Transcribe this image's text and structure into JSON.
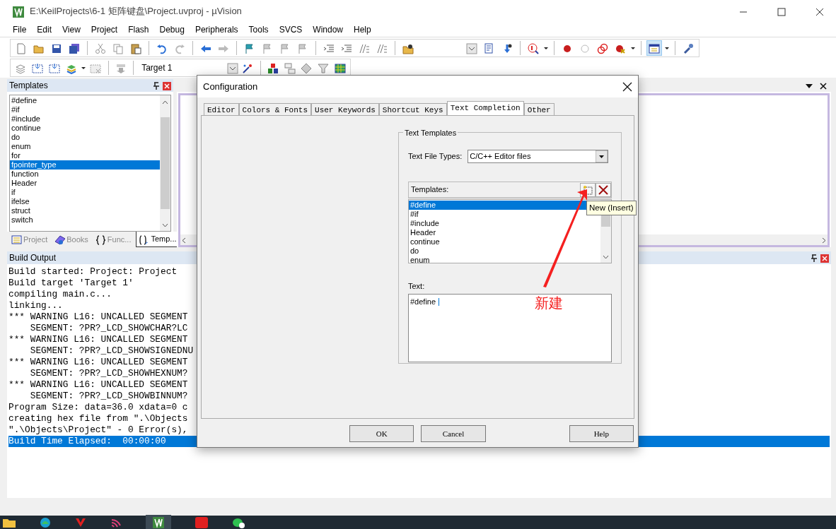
{
  "window": {
    "title": "E:\\KeilProjects\\6-1 矩阵键盘\\Project.uvproj - µVision"
  },
  "menu": [
    "File",
    "Edit",
    "View",
    "Project",
    "Flash",
    "Debug",
    "Peripherals",
    "Tools",
    "SVCS",
    "Window",
    "Help"
  ],
  "toolbar": {
    "target": "Target 1"
  },
  "templates_panel": {
    "title": "Templates",
    "items": [
      {
        "label": "#define",
        "selected": false
      },
      {
        "label": "#if",
        "selected": false
      },
      {
        "label": "#include",
        "selected": false
      },
      {
        "label": "continue",
        "selected": false
      },
      {
        "label": "do",
        "selected": false
      },
      {
        "label": "enum",
        "selected": false
      },
      {
        "label": "for",
        "selected": false
      },
      {
        "label": "fpointer_type",
        "selected": true
      },
      {
        "label": "function",
        "selected": false
      },
      {
        "label": "Header",
        "selected": false
      },
      {
        "label": "if",
        "selected": false
      },
      {
        "label": "ifelse",
        "selected": false
      },
      {
        "label": "struct",
        "selected": false
      },
      {
        "label": "switch",
        "selected": false
      }
    ],
    "tabs": [
      {
        "label": "Project",
        "kind": "project",
        "selected": false
      },
      {
        "label": "Books",
        "kind": "books",
        "selected": false
      },
      {
        "label": "Func...",
        "kind": "functions",
        "selected": false
      },
      {
        "label": "Temp...",
        "kind": "templates",
        "selected": true
      }
    ]
  },
  "build_output": {
    "title": "Build Output",
    "lines": [
      {
        "text": "Build started: Project: Project",
        "selected": false
      },
      {
        "text": "Build target 'Target 1'",
        "selected": false
      },
      {
        "text": "compiling main.c...",
        "selected": false
      },
      {
        "text": "linking...",
        "selected": false
      },
      {
        "text": "*** WARNING L16: UNCALLED SEGMENT",
        "selected": false
      },
      {
        "text": "    SEGMENT: ?PR?_LCD_SHOWCHAR?LC",
        "selected": false
      },
      {
        "text": "*** WARNING L16: UNCALLED SEGMENT",
        "selected": false
      },
      {
        "text": "    SEGMENT: ?PR?_LCD_SHOWSIGNEDNU",
        "selected": false
      },
      {
        "text": "*** WARNING L16: UNCALLED SEGMENT",
        "selected": false
      },
      {
        "text": "    SEGMENT: ?PR?_LCD_SHOWHEXNUM?",
        "selected": false
      },
      {
        "text": "*** WARNING L16: UNCALLED SEGMENT",
        "selected": false
      },
      {
        "text": "    SEGMENT: ?PR?_LCD_SHOWBINNUM?",
        "selected": false
      },
      {
        "text": "Program Size: data=36.0 xdata=0 c",
        "selected": false
      },
      {
        "text": "creating hex file from \".\\Objects",
        "selected": false
      },
      {
        "text": "\".\\Objects\\Project\" - 0 Error(s),",
        "selected": false
      },
      {
        "text": "Build Time Elapsed:  00:00:00",
        "selected": true
      }
    ]
  },
  "dialog": {
    "title": "Configuration",
    "tabs": [
      {
        "label": "Editor",
        "selected": false
      },
      {
        "label": "Colors & Fonts",
        "selected": false
      },
      {
        "label": "User Keywords",
        "selected": false
      },
      {
        "label": "Shortcut Keys",
        "selected": false
      },
      {
        "label": "Text Completion",
        "selected": true
      },
      {
        "label": "Other",
        "selected": false
      }
    ],
    "group_title": "Text Templates",
    "file_types_label": "Text File Types:",
    "file_types_value": "C/C++ Editor files",
    "templates_label": "Templates:",
    "templates": [
      {
        "label": "#define",
        "selected": true
      },
      {
        "label": "#if",
        "selected": false
      },
      {
        "label": "#include",
        "selected": false
      },
      {
        "label": "Header",
        "selected": false
      },
      {
        "label": "continue",
        "selected": false
      },
      {
        "label": "do",
        "selected": false
      },
      {
        "label": "enum",
        "selected": false
      }
    ],
    "text_label": "Text:",
    "text_value": "#define ",
    "tooltip": "New (Insert)",
    "buttons": [
      "OK",
      "Cancel",
      "Help"
    ]
  },
  "annotation": {
    "text": "新建"
  }
}
